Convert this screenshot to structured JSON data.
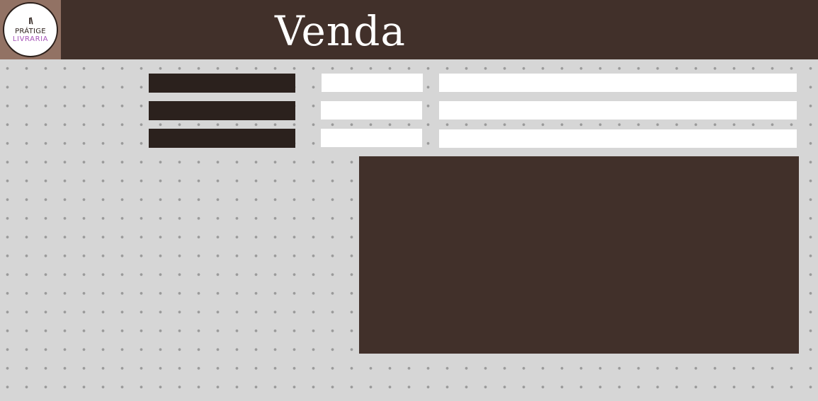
{
  "app": {
    "title": "Venda",
    "logo": {
      "mark": "I\\",
      "line1": "PRÁTIGE",
      "line2": "LIVRARIA"
    }
  },
  "colors": {
    "header_bg": "#41302a",
    "logo_bg": "#927264",
    "button_bg": "#2b211d",
    "panel_bg": "#41302a",
    "page_bg": "#d6d6d6",
    "logo_accent": "#a653b8"
  },
  "buttons": [
    {
      "label": ""
    },
    {
      "label": ""
    },
    {
      "label": ""
    }
  ],
  "fields": {
    "short": [
      {
        "value": "",
        "placeholder": ""
      },
      {
        "value": "",
        "placeholder": ""
      },
      {
        "value": "",
        "placeholder": ""
      }
    ],
    "long": [
      {
        "value": "",
        "placeholder": ""
      },
      {
        "value": "",
        "placeholder": ""
      },
      {
        "value": "",
        "placeholder": ""
      }
    ]
  }
}
